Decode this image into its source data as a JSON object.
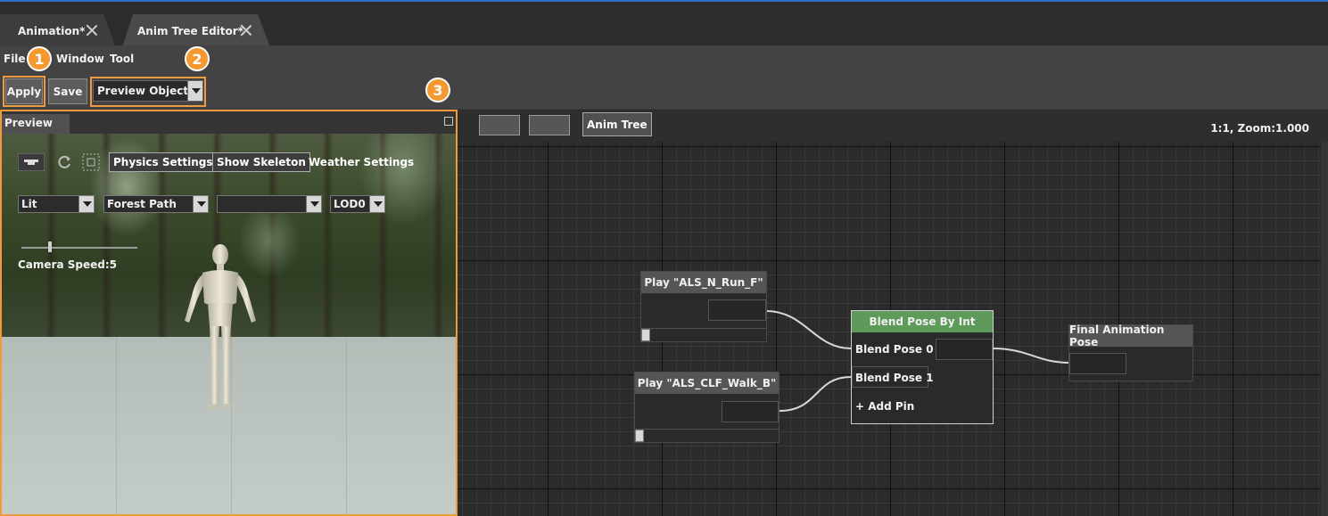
{
  "tabs": [
    {
      "label": "Animation*"
    },
    {
      "label": "Anim Tree Editor*"
    }
  ],
  "menu": {
    "file": "File",
    "window": "Window",
    "tool": "Tool"
  },
  "toolbar": {
    "apply_label": "Apply",
    "save_label": "Save",
    "preview_object_label": "Preview Object"
  },
  "badges": [
    "1",
    "2",
    "3"
  ],
  "preview": {
    "title": "Preview",
    "buttons": {
      "physics": "Physics Settings",
      "skeleton": "Show Skeleton",
      "weather": "Weather Settings"
    },
    "selects": {
      "lighting": "Lit",
      "scene": "Forest Path",
      "extra": "",
      "lod": "LOD0"
    },
    "camera_speed_label": "Camera Speed:5"
  },
  "graph": {
    "anim_tree_label": "Anim Tree",
    "zoom_label": "1:1, Zoom:1.000",
    "nodes": {
      "play_run": "Play \"ALS_N_Run_F\"",
      "play_walk": "Play \"ALS_CLF_Walk_B\"",
      "blend": "Blend Pose By Int",
      "blend_pose_0": "Blend Pose 0",
      "blend_pose_1": "Blend Pose 1",
      "add_pin": "+ Add Pin",
      "final": "Final Animation Pose"
    }
  },
  "colors": {
    "highlight": "#f09a3e",
    "badge": "#f4982f",
    "blend_header": "#5e9a5a",
    "accent_top": "#2f6fc5"
  }
}
